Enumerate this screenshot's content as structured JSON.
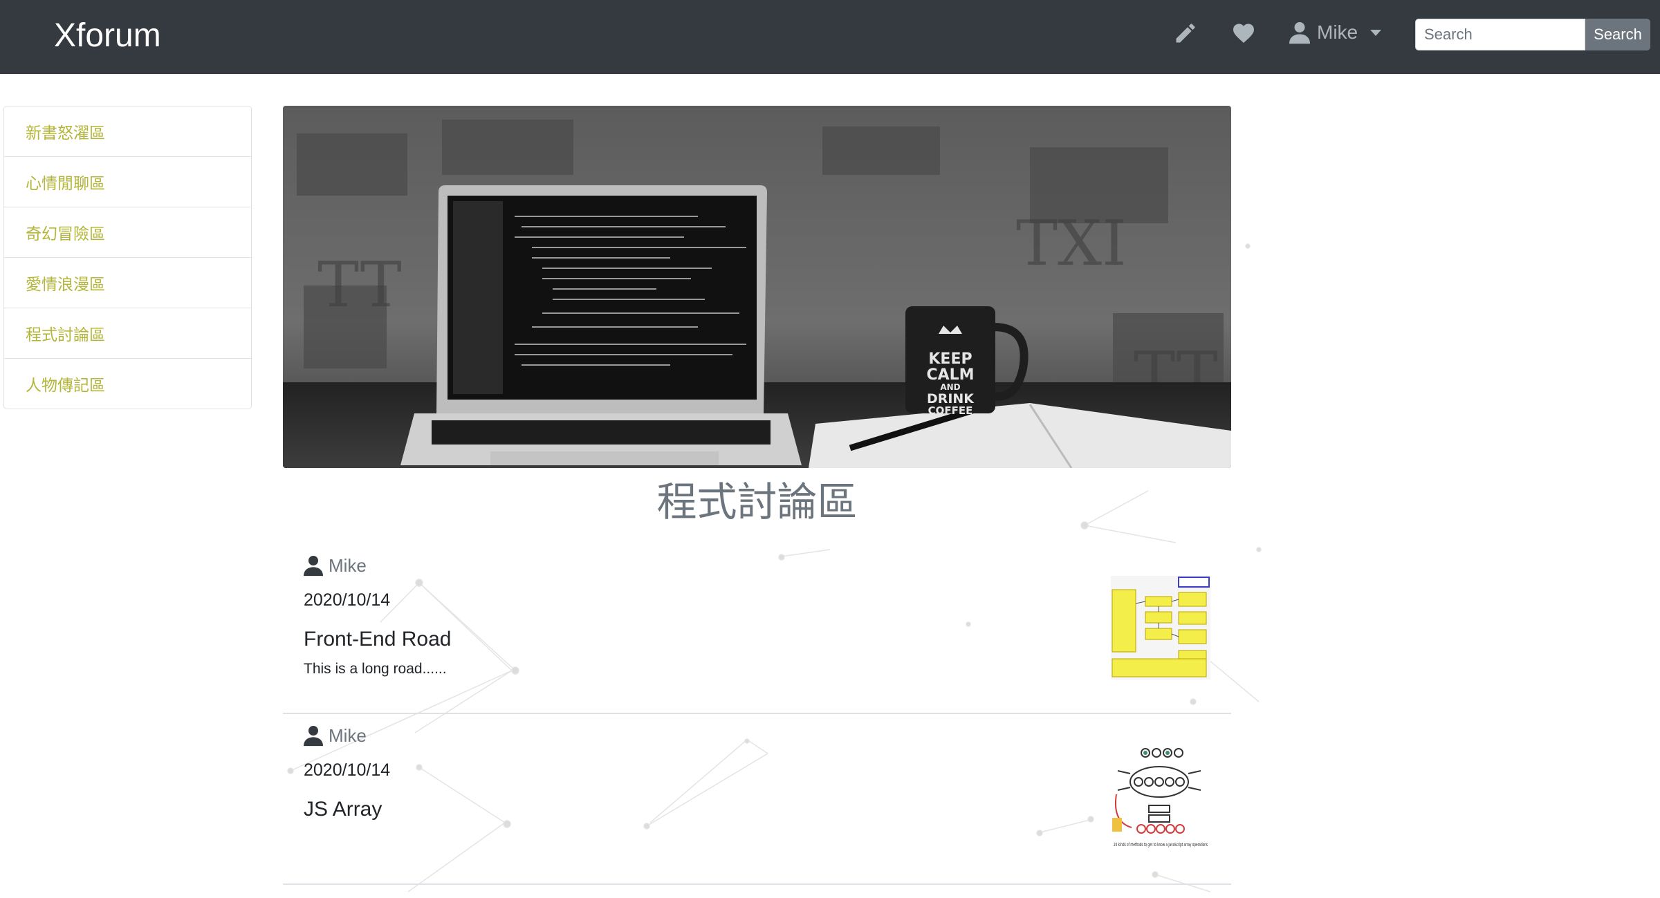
{
  "navbar": {
    "brand": "Xforum",
    "icons": [
      "pencil-icon",
      "heart-icon",
      "user-icon",
      "caret-down-icon"
    ],
    "user_name": "Mike",
    "search": {
      "placeholder": "Search",
      "button_label": "Search"
    }
  },
  "sidebar": {
    "items": [
      {
        "label": "新書怒濯區"
      },
      {
        "label": "心情閒聊區"
      },
      {
        "label": "奇幻冒險區"
      },
      {
        "label": "愛情浪漫區"
      },
      {
        "label": "程式討論區"
      },
      {
        "label": "人物傳記區"
      }
    ],
    "link_color": "#b4b63a"
  },
  "hero": {
    "mug_text": [
      "KEEP",
      "CALM",
      "AND",
      "DRINK",
      "COFFEE"
    ]
  },
  "board": {
    "title": "程式討論區"
  },
  "posts": [
    {
      "author": "Mike",
      "date": "2020/10/14",
      "title": "Front-End Road",
      "excerpt": "This is a long road......"
    },
    {
      "author": "Mike",
      "date": "2020/10/14",
      "title": "JS Array",
      "excerpt": "",
      "thumb_caption": "20 kinds of methods to get to know a JavaScript array operations"
    }
  ],
  "colors": {
    "navbar_bg": "#343a40",
    "muted": "#6c757d",
    "border": "#dee2e6"
  }
}
